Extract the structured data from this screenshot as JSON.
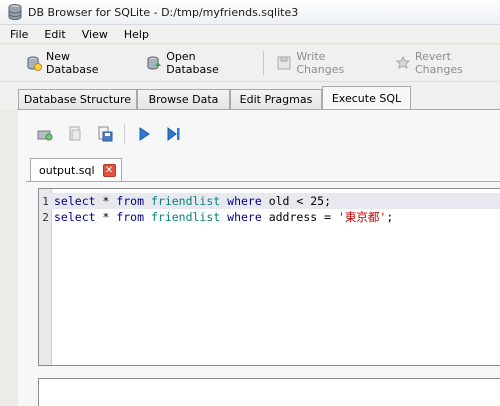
{
  "window": {
    "title": "DB Browser for SQLite - D:/tmp/myfriends.sqlite3",
    "icon": "database-icon"
  },
  "menu": [
    "File",
    "Edit",
    "View",
    "Help"
  ],
  "toolbar": {
    "new_database": "New Database",
    "open_database": "Open Database",
    "write_changes": "Write Changes",
    "revert_changes": "Revert Changes"
  },
  "tabs": [
    "Database Structure",
    "Browse Data",
    "Edit Pragmas",
    "Execute SQL"
  ],
  "active_tab": "Execute SQL",
  "sql_toolbar": [
    "open-tab-icon",
    "open-sql-file-icon",
    "save-sql-file-icon",
    "execute-all-icon",
    "execute-current-line-icon"
  ],
  "editor": {
    "file_tab": "output.sql",
    "close_glyph": "✕",
    "lines": [
      {
        "number": "1",
        "tokens": [
          {
            "t": "select",
            "c": "kw"
          },
          {
            "t": " * ",
            "c": "op"
          },
          {
            "t": "from",
            "c": "kw"
          },
          {
            "t": " ",
            "c": "op"
          },
          {
            "t": "friendlist",
            "c": "tbl"
          },
          {
            "t": " ",
            "c": "op"
          },
          {
            "t": "where",
            "c": "kw"
          },
          {
            "t": " old < 25;",
            "c": "col"
          }
        ]
      },
      {
        "number": "2",
        "tokens": [
          {
            "t": "select",
            "c": "kw"
          },
          {
            "t": " * ",
            "c": "op"
          },
          {
            "t": "from",
            "c": "kw"
          },
          {
            "t": " ",
            "c": "op"
          },
          {
            "t": "friendlist",
            "c": "tbl"
          },
          {
            "t": " ",
            "c": "op"
          },
          {
            "t": "where",
            "c": "kw"
          },
          {
            "t": " address = ",
            "c": "col"
          },
          {
            "t": "'東京都'",
            "c": "str"
          },
          {
            "t": ";",
            "c": "op"
          }
        ]
      }
    ]
  },
  "colors": {
    "keyword": "#00008b",
    "table": "#0b7f7f",
    "string": "#c00000",
    "close": "#e0533e"
  }
}
